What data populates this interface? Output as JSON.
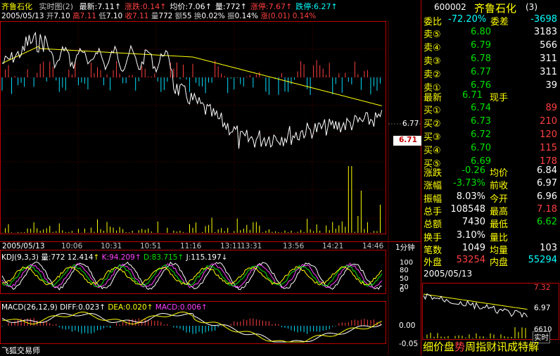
{
  "header": {
    "stock_name": "齐鲁石化",
    "mode": "实时图(2)",
    "items": [
      {
        "label": "最新",
        "value": "7.11",
        "color": "#ffffff"
      },
      {
        "label": "涨跌",
        "value": "0.14",
        "color": "#ff4040"
      },
      {
        "label": "均价",
        "value": "7.06",
        "color": "#ffffff"
      },
      {
        "label": "量",
        "value": "772",
        "color": "#ffffff"
      },
      {
        "label": "涨停",
        "value": "7.67",
        "color": "#ff4040"
      },
      {
        "label": "跌停",
        "value": "6.27",
        "color": "#00ffff"
      }
    ],
    "line2": {
      "date": "2005/05/13",
      "open_label": "开",
      "open": "7.10",
      "high_label": "高",
      "high": "7.11",
      "low_label": "低",
      "low": "7.10",
      "close_label": "收",
      "close": "7.11",
      "vol_label": "量",
      "vol": "772",
      "amt_label": "额",
      "amt": "55",
      "turn_label": "换",
      "turn": "0.02%",
      "amp_label": "振",
      "amp": "0.14%",
      "chg_label": "涨",
      "chg": "(0.01)",
      "chg_pct": "0.14%"
    }
  },
  "price_axis": {
    "tick1": "6.77",
    "current": "6.71"
  },
  "time_axis": {
    "labels": [
      "2005/05/13",
      "10:06",
      "10:31",
      "10:51",
      "11:16",
      "13:11",
      "13:31",
      "13:56",
      "14:21",
      "14:46"
    ],
    "period": "1分钟"
  },
  "kdj": {
    "title": "KDJ(9,3,3)",
    "vol_label": "量",
    "vol": "772",
    "ma_value": "12.414",
    "k_label": "K",
    "k": "94.209",
    "d_label": "D",
    "d": "83.715",
    "j_label": "J",
    "j": "115.197",
    "ticks": [
      "100",
      "80",
      "50",
      "20",
      "0"
    ]
  },
  "macd": {
    "title": "MACD(26,12,9)",
    "diff_label": "DIFF",
    "diff": "0.023",
    "dea_label": "DEA",
    "dea": "0.020",
    "macd_label": "MACD",
    "macd": "0.006",
    "ticks": [
      "0.00",
      "-0.05"
    ]
  },
  "footer": {
    "brand": "飞狐交易师"
  },
  "panel": {
    "code": "600002",
    "name": "齐鲁石化",
    "num": "(3)",
    "weibi_label": "委比",
    "weibi": "-72.20%",
    "weicha_label": "委差",
    "weicha": "-3698",
    "asks": [
      {
        "label": "卖⑤",
        "price": "6.80",
        "vol": "3183"
      },
      {
        "label": "卖④",
        "price": "6.79",
        "vol": "566"
      },
      {
        "label": "卖③",
        "price": "6.78",
        "vol": "311"
      },
      {
        "label": "卖②",
        "price": "6.77",
        "vol": "311"
      },
      {
        "label": "卖①",
        "price": "6.76",
        "vol": "39"
      }
    ],
    "latest_label": "最新",
    "latest": "6.71",
    "xianshou_label": "现手",
    "bids": [
      {
        "label": "买①",
        "price": "6.74",
        "vol": "89"
      },
      {
        "label": "买②",
        "price": "6.73",
        "vol": "210"
      },
      {
        "label": "买③",
        "price": "6.72",
        "vol": "120"
      },
      {
        "label": "买④",
        "price": "6.70",
        "vol": "115"
      },
      {
        "label": "买⑤",
        "price": "6.69",
        "vol": "178"
      }
    ],
    "stats": [
      {
        "l1": "涨跌",
        "v1": "-0.26",
        "c1": "#00e000",
        "l2": "均价",
        "v2": "6.84",
        "c2": "#ffffff"
      },
      {
        "l1": "涨幅",
        "v1": "-3.73%",
        "c1": "#00e000",
        "l2": "前收",
        "v2": "6.97",
        "c2": "#ffffff"
      },
      {
        "l1": "振幅",
        "v1": "8.03%",
        "c1": "#ffffff",
        "l2": "今开",
        "v2": "6.96",
        "c2": "#ffffff"
      },
      {
        "l1": "总手",
        "v1": "108548",
        "c1": "#ffffff",
        "l2": "最高",
        "v2": "7.18",
        "c2": "#ff4040"
      },
      {
        "l1": "总额",
        "v1": "7430",
        "c1": "#ffffff",
        "l2": "最低",
        "v2": "6.62",
        "c2": "#00e000"
      },
      {
        "l1": "换手",
        "v1": "3.10%",
        "c1": "#ffffff",
        "l2": "量比",
        "v2": "",
        "c2": "#ffffff"
      },
      {
        "l1": "笔数",
        "v1": "1049",
        "c1": "#ffffff",
        "l2": "均量",
        "v2": "103",
        "c2": "#ffffff"
      }
    ],
    "waipan_label": "外盘",
    "waipan": "53254",
    "neipan_label": "内盘",
    "neipan": "55294",
    "mini_date": "2005/05/13",
    "mini_high": "7.32",
    "mini_mid": "6.97",
    "mini_low": "6610",
    "mini_btn": "实时"
  },
  "tabs": [
    "细",
    "价",
    "盘",
    "势",
    "周",
    "指",
    "财",
    "讯",
    "成",
    "特",
    "解"
  ],
  "colors": {
    "up": "#ff4040",
    "down": "#00e000",
    "frame": "#c00000",
    "price": "#ffffff",
    "avg": "#ffff00"
  }
}
